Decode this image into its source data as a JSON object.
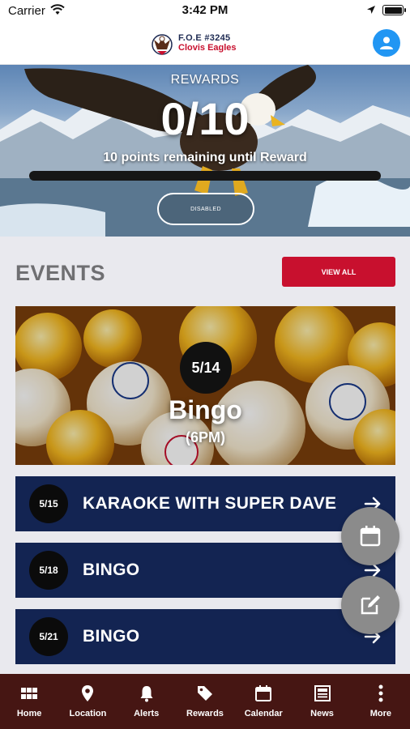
{
  "status_bar": {
    "carrier": "Carrier",
    "time": "3:42 PM"
  },
  "header": {
    "brand_line1": "F.O.E #3245",
    "brand_line2": "Clovis Eagles",
    "avatar_icon": "user-icon"
  },
  "rewards": {
    "label": "REWARDS",
    "count": "0/10",
    "remaining_text": "10 points remaining until Reward",
    "progress_fraction": 0.0,
    "button_label": "DISABLED"
  },
  "events": {
    "title": "EVENTS",
    "view_all_label": "VIEW ALL",
    "featured": {
      "date": "5/14",
      "title": "Bingo",
      "time": "(6PM)"
    },
    "list": [
      {
        "date": "5/15",
        "name": "KARAOKE WITH SUPER DAVE"
      },
      {
        "date": "5/18",
        "name": "BINGO"
      },
      {
        "date": "5/21",
        "name": "BINGO"
      }
    ]
  },
  "fabs": {
    "calendar_icon": "calendar-icon",
    "edit_icon": "edit-icon"
  },
  "tabs": [
    {
      "label": "Home",
      "icon": "home-grid-icon"
    },
    {
      "label": "Location",
      "icon": "location-pin-icon"
    },
    {
      "label": "Alerts",
      "icon": "bell-icon"
    },
    {
      "label": "Rewards",
      "icon": "tag-icon"
    },
    {
      "label": "Calendar",
      "icon": "calendar-icon"
    },
    {
      "label": "News",
      "icon": "newspaper-icon"
    },
    {
      "label": "More",
      "icon": "more-vertical-icon"
    }
  ],
  "colors": {
    "accent_red": "#c8102e",
    "event_navy": "#132452",
    "tabbar_brown": "#461613",
    "avatar_blue": "#2196f3"
  }
}
